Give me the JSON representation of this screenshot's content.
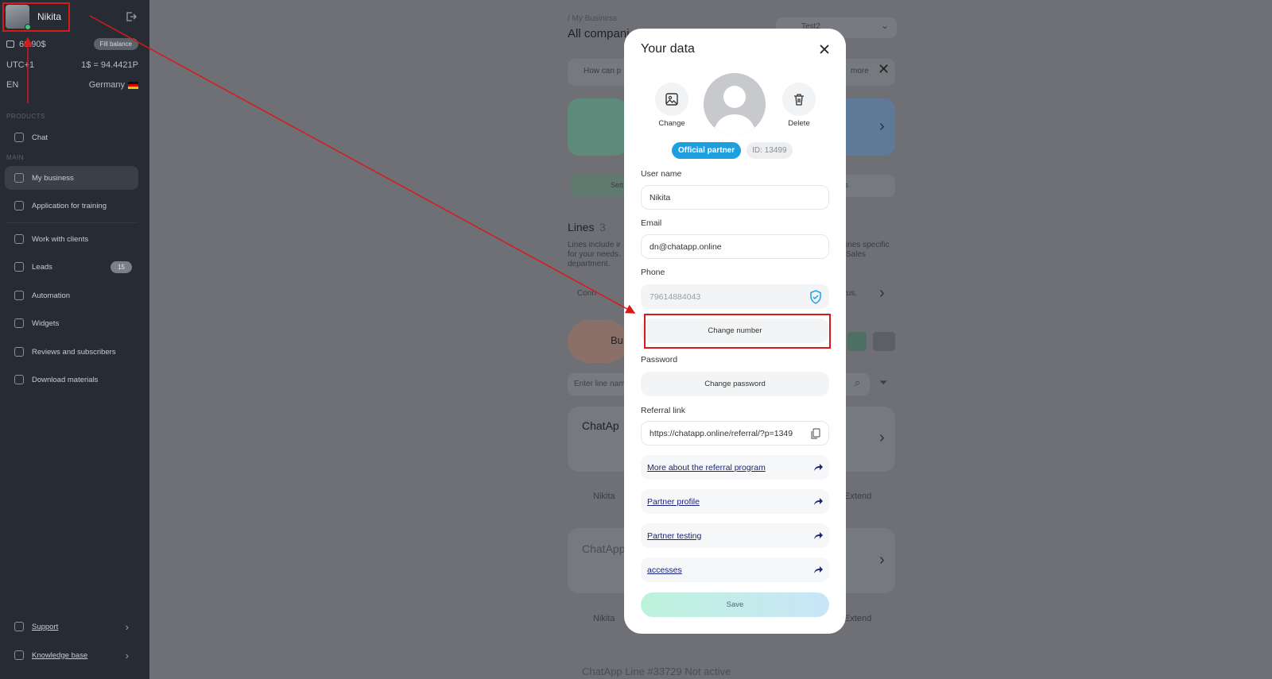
{
  "sidebar": {
    "username": "Nikita",
    "balance": "66.90$",
    "fill_balance": "Fill balance",
    "timezone": "UTC+1",
    "rate": "1$ = 94.4421P",
    "language": "EN",
    "country": "Germany",
    "section_products": "PRODUCTS",
    "section_main": "MAIN",
    "items": [
      {
        "label": "Chat"
      },
      {
        "label": "My business"
      },
      {
        "label": "Application for training"
      },
      {
        "label": "Work with clients"
      },
      {
        "label": "Leads",
        "badge": "15"
      },
      {
        "label": "Automation"
      },
      {
        "label": "Widgets"
      },
      {
        "label": "Reviews and subscribers"
      },
      {
        "label": "Download materials"
      }
    ],
    "support": "Support",
    "knowledge": "Knowledge base"
  },
  "background": {
    "breadcrumb": "/ My Business",
    "page_title": "All compani",
    "company_select": "Test2",
    "help_prompt": "How can p",
    "help_more": "more",
    "tab_settings": "Sett",
    "tab_metrics": "rics",
    "lines_title": "Lines",
    "lines_count": "3",
    "lines_desc_left": "Lines include ir\nfor your needs.\ndepartment.",
    "lines_desc_right": "ines specific\nSales",
    "connect_text": "Conn",
    "connect_right": "tus.",
    "bu_text": "Bu",
    "search_placeholder": "Enter line nam",
    "card1_title": "ChatAp",
    "owner1": "Nikita",
    "extend1": "Extend",
    "card2_title": "ChatApp",
    "owner2": "Nikita",
    "extend2": "Extend",
    "footer_line": "ChatApp Line #33729 Not active"
  },
  "modal": {
    "title": "Your data",
    "change_photo": "Change",
    "delete_photo": "Delete",
    "badge_partner": "Official partner",
    "badge_id": "ID: 13499",
    "username_label": "User name",
    "username_value": "Nikita",
    "email_label": "Email",
    "email_value": "dn@chatapp.online",
    "phone_label": "Phone",
    "phone_value": "79614884043",
    "change_number": "Change number",
    "password_label": "Password",
    "change_password": "Change password",
    "referral_label": "Referral link",
    "referral_value": "https://chatapp.online/referral/?p=1349",
    "links": [
      {
        "label": "More about the referral program"
      },
      {
        "label": "Partner profile"
      },
      {
        "label": "Partner testing"
      },
      {
        "label": "accesses"
      }
    ],
    "save": "Save"
  },
  "colors": {
    "sidebar_bg": "#272b33",
    "overlay": "#6f7075",
    "partner_badge": "#1d9fe0",
    "link": "#1a237e",
    "annotation_red": "#d61a1a"
  }
}
